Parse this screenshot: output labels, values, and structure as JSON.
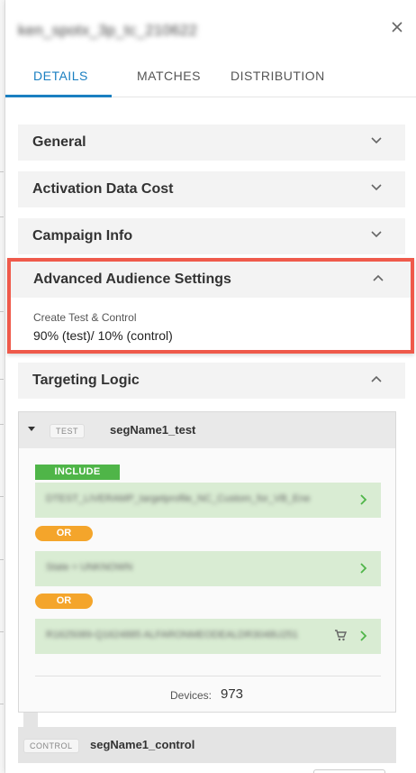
{
  "panel": {
    "title": "ken_spotx_3p_tc_210622",
    "close_icon": "close-icon"
  },
  "tabs": [
    {
      "label": "DETAILS",
      "active": true
    },
    {
      "label": "MATCHES",
      "active": false
    },
    {
      "label": "DISTRIBUTION",
      "active": false
    }
  ],
  "sections": {
    "general": "General",
    "activation": "Activation Data Cost",
    "campaign": "Campaign Info",
    "advanced": {
      "label": "Advanced Audience Settings",
      "field_label": "Create Test & Control",
      "field_value": "90% (test)/ 10% (control)"
    },
    "targeting": "Targeting Logic"
  },
  "segment_test": {
    "tag": "TEST",
    "name": "segName1_test",
    "include_label": "INCLUDE",
    "rules": [
      "DTEST_LIVERAMP_targetprofile_NC_Custom_for_VB_Ene",
      "State = UNKNOWN",
      "R1625089-Q1624885 ALFARONMEODEALDR3048U251"
    ],
    "or_label": "OR",
    "devices_label": "Devices:",
    "devices_count": "973"
  },
  "segment_control": {
    "tag": "CONTROL",
    "name": "segName1_control"
  },
  "colors": {
    "accent": "#1a7fc1",
    "highlight_border": "#ef5a4b",
    "include": "#4fb548",
    "or": "#f4a52b",
    "rule_bg": "#d9ecd3"
  }
}
